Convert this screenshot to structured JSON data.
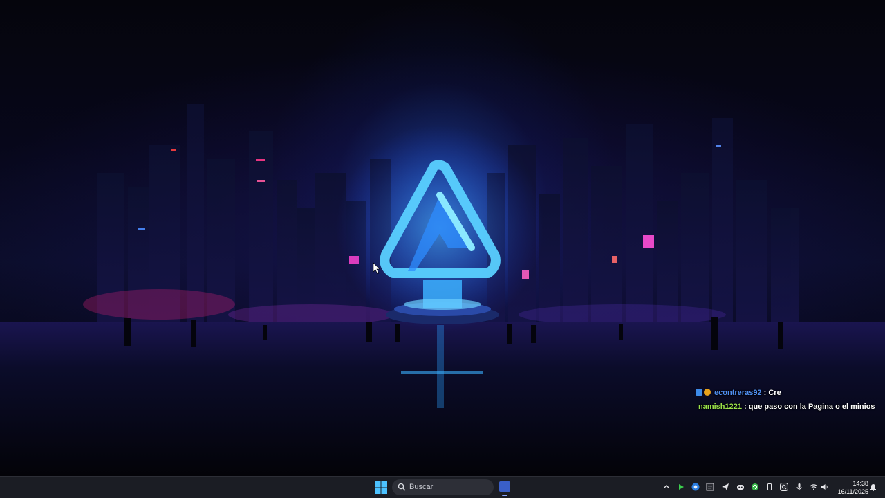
{
  "chat": {
    "messages": [
      {
        "user": "econtreras92",
        "text": "Cre"
      },
      {
        "user": "namish1221",
        "text": "que paso con la Pagina o el minios"
      }
    ]
  },
  "taskbar": {
    "search_placeholder": "Buscar",
    "clock_time": "14:38",
    "clock_date": "16/11/2025",
    "pinned_app_icon": "app-icon",
    "tray_icons": [
      "chevron-up-icon",
      "play-icon",
      "browser-icon",
      "app-icon",
      "send-icon",
      "discord-icon",
      "refresh-icon",
      "battery-icon",
      "search-icon",
      "microphone-icon",
      "wifi-icon",
      "volume-icon",
      "notification-icon"
    ]
  },
  "colors": {
    "taskbar_bg": "#1b1d24",
    "chat_user1": "#4f8ef0",
    "chat_user2": "#9be24a",
    "logo_glow": "#3aa8ff"
  }
}
